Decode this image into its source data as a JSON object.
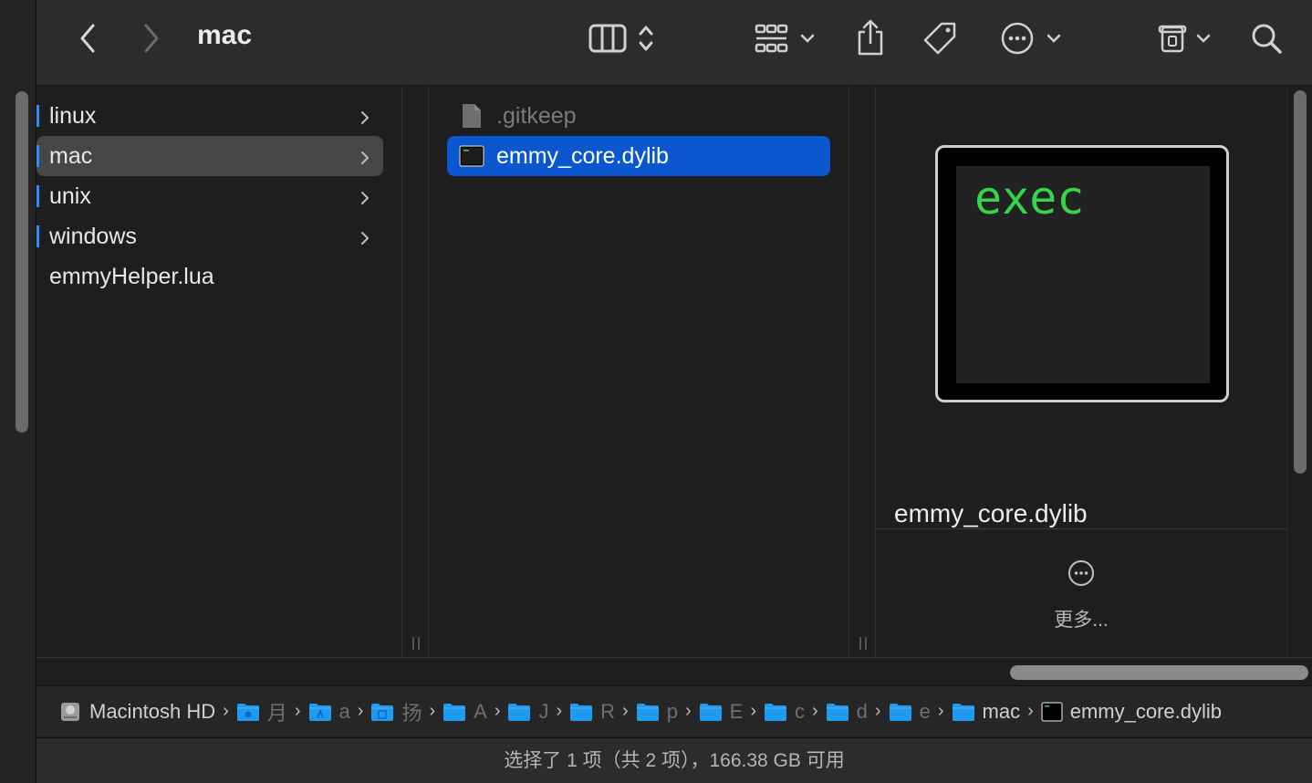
{
  "toolbar": {
    "title": "mac",
    "back_icon": "chevron-left-icon",
    "forward_icon": "chevron-right-icon",
    "view_icon": "column-view-icon",
    "group_icon": "grid-group-icon",
    "share_icon": "share-icon",
    "tag_icon": "tag-icon",
    "more_icon": "ellipsis-circle-icon",
    "archive_icon": "archive-icon",
    "search_icon": "search-icon"
  },
  "column1": {
    "items": [
      {
        "label": "linux",
        "folder": true
      },
      {
        "label": "mac",
        "folder": true,
        "selected": true
      },
      {
        "label": "unix",
        "folder": true
      },
      {
        "label": "windows",
        "folder": true
      },
      {
        "label": "emmyHelper.lua",
        "folder": false
      }
    ]
  },
  "column2": {
    "items": [
      {
        "label": ".gitkeep",
        "icon": "document-icon",
        "dim": true
      },
      {
        "label": "emmy_core.dylib",
        "icon": "terminal-exec-icon",
        "selected": true
      }
    ]
  },
  "preview": {
    "thumbnail_text": "exec",
    "filename": "emmy_core.dylib",
    "more_label": "更多..."
  },
  "pathbar": {
    "crumbs": [
      {
        "label": "Macintosh HD",
        "icon": "harddrive-icon",
        "dim": false
      },
      {
        "label": "月",
        "icon": "user-folder-icon",
        "dim": true
      },
      {
        "label": "a",
        "icon": "app-folder-icon",
        "dim": true
      },
      {
        "label": "扬",
        "icon": "library-folder-icon",
        "dim": true
      },
      {
        "label": "A",
        "icon": "folder-icon",
        "dim": true
      },
      {
        "label": "J",
        "icon": "folder-icon",
        "dim": true
      },
      {
        "label": "R",
        "icon": "folder-icon",
        "dim": true
      },
      {
        "label": "p",
        "icon": "folder-icon",
        "dim": true
      },
      {
        "label": "E",
        "icon": "folder-icon",
        "dim": true
      },
      {
        "label": "c",
        "icon": "folder-icon",
        "dim": true
      },
      {
        "label": "d",
        "icon": "folder-icon",
        "dim": true
      },
      {
        "label": "e",
        "icon": "folder-icon",
        "dim": true
      },
      {
        "label": "mac",
        "icon": "folder-icon",
        "dim": false
      },
      {
        "label": "emmy_core.dylib",
        "icon": "terminal-exec-icon",
        "dim": false,
        "last": true
      }
    ]
  },
  "status": {
    "text": "选择了 1 项（共 2 项），166.38 GB 可用"
  },
  "colors": {
    "accent": "#0b57d0",
    "tag_blue": "#2f8cf5",
    "folder_blue": "#1e9bf0",
    "exec_green": "#35d44a"
  }
}
